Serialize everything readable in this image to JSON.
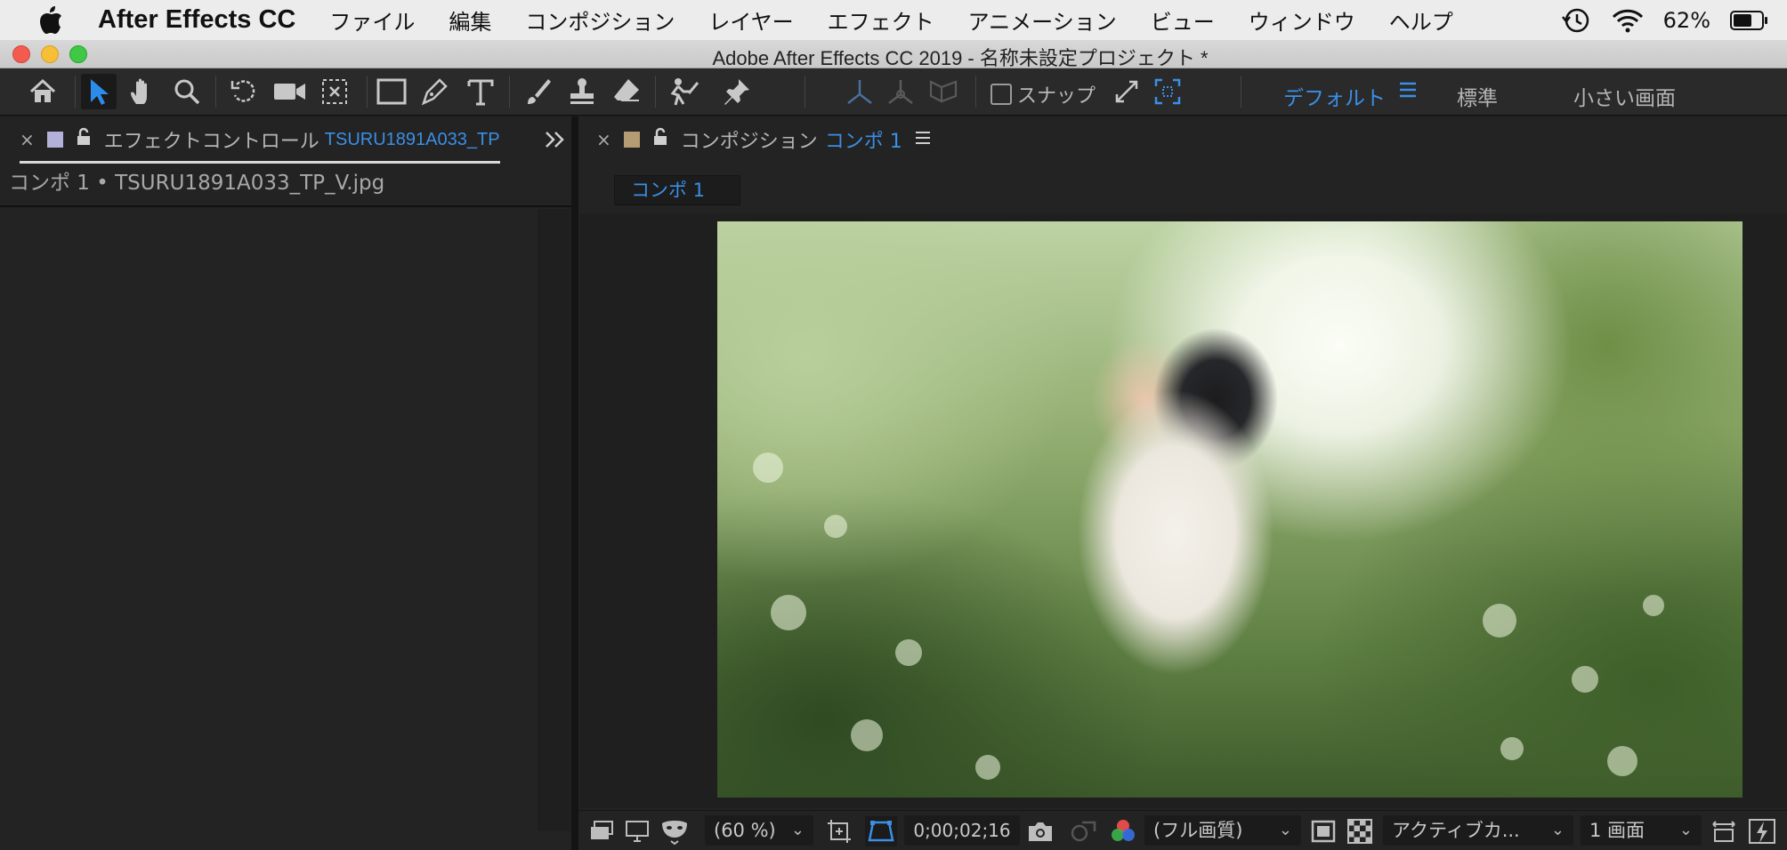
{
  "menubar": {
    "app_name": "After Effects CC",
    "items": [
      "ファイル",
      "編集",
      "コンポジション",
      "レイヤー",
      "エフェクト",
      "アニメーション",
      "ビュー",
      "ウィンドウ",
      "ヘルプ"
    ],
    "battery": "62%"
  },
  "window": {
    "title": "Adobe After Effects CC 2019 - 名称未設定プロジェクト *"
  },
  "toolbar": {
    "snap_label": "スナップ",
    "workspaces": {
      "active": "デフォルト",
      "standard": "標準",
      "small_screen": "小さい画面"
    }
  },
  "effects_panel": {
    "tab_label": "エフェクトコントロール",
    "tab_layer": "TSURU1891A033_TP",
    "subtitle": "コンポ 1 • TSURU1891A033_TP_V.jpg"
  },
  "comp_panel": {
    "tab_label": "コンポジション",
    "tab_comp": "コンポ 1",
    "sub_tab": "コンポ 1"
  },
  "viewer_status": {
    "zoom": "(60 %)",
    "timecode": "0;00;02;16",
    "resolution": "(フル画質)",
    "camera": "アクティブカ...",
    "views": "1 画面"
  },
  "colors": {
    "accent": "#3a8fe6",
    "panel": "#232323",
    "effects_swatch": "#b3b0d9",
    "comp_swatch": "#b59c74"
  }
}
